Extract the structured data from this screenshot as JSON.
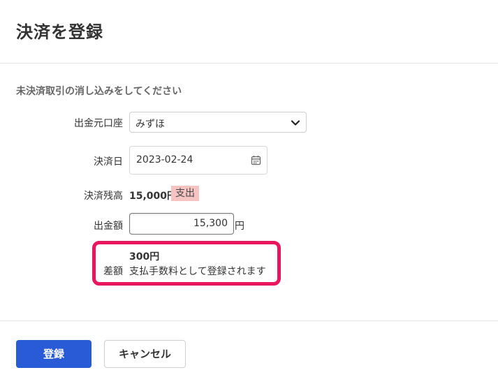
{
  "dialog": {
    "title": "決済を登録"
  },
  "form": {
    "subtitle": "未決済取引の消し込みをしてください",
    "account": {
      "label": "出金元口座",
      "value": "みずほ"
    },
    "date": {
      "label": "決済日",
      "value": "2023-02-24"
    },
    "balance": {
      "label": "決済残高",
      "value": "15,000円",
      "badge": "支出"
    },
    "amount": {
      "label": "出金額",
      "value": "15,300",
      "unit": "円"
    },
    "difference": {
      "label": "差額",
      "amount": "300円",
      "description": "支払手数料として登録されます"
    }
  },
  "buttons": {
    "register": "登録",
    "cancel": "キャンセル"
  },
  "colors": {
    "primary": "#2a5bd7",
    "highlight": "#e9165d",
    "badge": "#f6c3c3"
  },
  "icons": {
    "dropdown": "chevron-down-icon",
    "calendar": "calendar-icon"
  }
}
